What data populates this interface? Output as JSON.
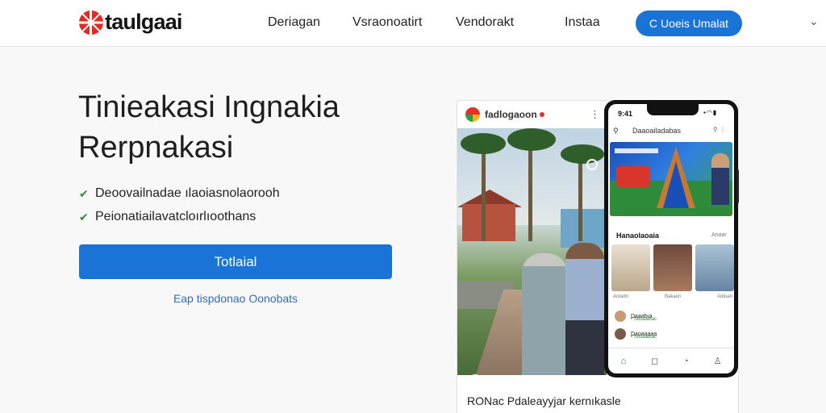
{
  "brand": {
    "name": "taulgaai"
  },
  "nav": [
    "Deriagan",
    "Vsraonoatirt",
    "Vendorakt",
    "Instaa"
  ],
  "header_cta": {
    "icon": "C",
    "label": "Uoeis Umalat"
  },
  "hero": {
    "title_line1": "Tinieakasi Ingnakia",
    "title_line2": "Rerpnakasi",
    "features": [
      "Deoovailnadae ılaoiasnolaorooh",
      "Peionatiailavatcloırlıoothans"
    ],
    "primary_button": "Totlaial",
    "secondary_link": "Eap tispdonao Oonobats"
  },
  "card": {
    "brand": "fadlogaoon",
    "caption": "RONac Pdaleayyjar kernıkasle"
  },
  "phone": {
    "time": "9:41",
    "search": "Daaoailadabas",
    "section": "Hanaolaoaia",
    "section_more": "Anaar",
    "thumb_captions": [
      "Aotadn",
      "Bakaon",
      "Aldoan"
    ],
    "rows": [
      {
        "name": "Daaabıa",
        "sub": "• Sdsaabtac"
      },
      {
        "name": "Daoaaaaa",
        "sub": "• Sdsaabtac"
      }
    ]
  },
  "icons": {
    "check": "check-icon",
    "search": "search-icon",
    "menu": "kebab-icon",
    "chevron": "chevron-down-icon",
    "home": "home-icon",
    "chat": "chat-icon",
    "clock": "clock-icon",
    "profile": "profile-icon"
  },
  "colors": {
    "accent": "#1a73d6",
    "brand_red": "#e52a24",
    "check_green": "#2e8b3b"
  }
}
